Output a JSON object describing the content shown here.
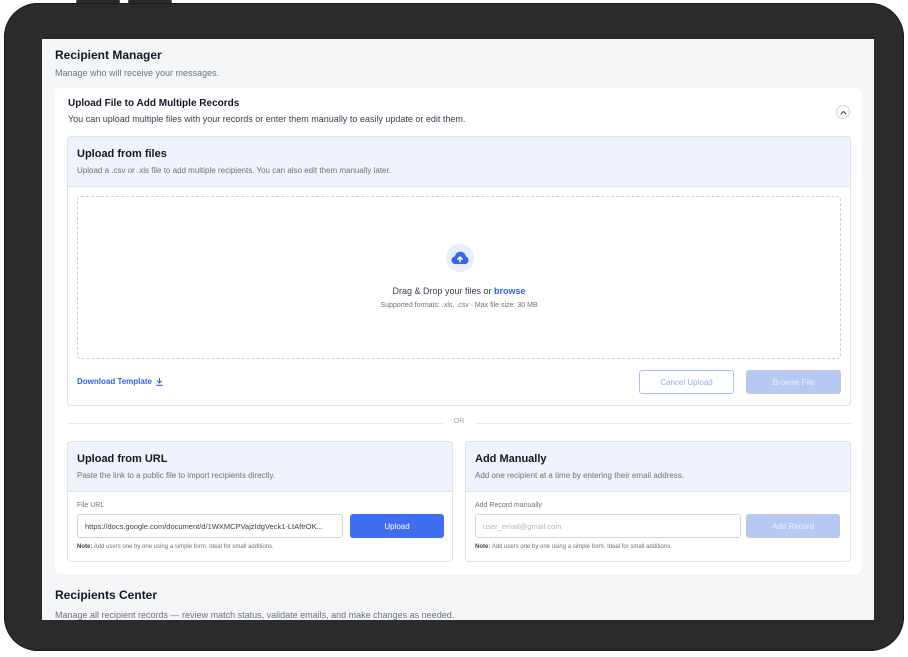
{
  "header": {
    "title": "Recipient Manager",
    "subtitle": "Manage who will receive your messages."
  },
  "upload_card": {
    "title": "Upload File to Add Multiple Records",
    "subtitle": "You can upload multiple files with your records or enter them manually to easily update or edit them.",
    "collapse_icon": "chevron-up-icon"
  },
  "files_panel": {
    "title": "Upload from files",
    "subtitle": "Upload a .csv or .xls file to add multiple recipients. You can also edit them manually later.",
    "drop_text": "Drag & Drop your files or",
    "browse_link": "browse",
    "formats": "Supported formats: .xls, .csv · Max file size: 30 MB",
    "upload_icon": "cloud-upload-icon",
    "download_template": "Download Template",
    "download_icon": "download-icon",
    "cancel_label": "Cancel Upload",
    "browse_label": "Browse File"
  },
  "divider": {
    "label": "OR"
  },
  "url_panel": {
    "title": "Upload from URL",
    "subtitle": "Paste the link to a public file to import recipients directly.",
    "field_label": "File URL",
    "field_value": "https://docs.google.com/document/d/1WXMCPVajzIdgVeck1-LtAftrOK...",
    "button_label": "Upload",
    "note_prefix": "Note:",
    "note_text": "Add users one by one using a simple form. Ideal for small additions."
  },
  "manual_panel": {
    "title": "Add Manually",
    "subtitle": "Add one recipient at a time by entering their email address.",
    "field_label": "Add Record manually",
    "field_placeholder": "user_email@gmail.com",
    "button_label": "Add Record",
    "note_prefix": "Note:",
    "note_text": "Add users one by one using a simple form. Ideal for small additions."
  },
  "recipients_center": {
    "title": "Recipients Center",
    "subtitle": "Manage all recipient records — review match status, validate emails, and make changes as needed."
  },
  "colors": {
    "accent": "#3f6ef0",
    "accent_disabled": "#b7c9f2",
    "panel_header": "#eef3fc",
    "device_frame": "#2b2b2b"
  }
}
